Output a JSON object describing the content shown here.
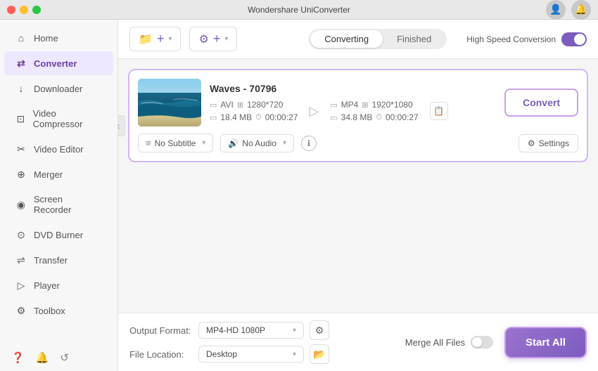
{
  "app": {
    "title": "Wondershare UniConverter"
  },
  "titlebar": {
    "dots": [
      "red",
      "yellow",
      "green"
    ]
  },
  "sidebar": {
    "items": [
      {
        "id": "home",
        "label": "Home",
        "icon": "⌂",
        "active": false
      },
      {
        "id": "converter",
        "label": "Converter",
        "icon": "⇄",
        "active": true
      },
      {
        "id": "downloader",
        "label": "Downloader",
        "icon": "↓",
        "active": false
      },
      {
        "id": "video-compressor",
        "label": "Video Compressor",
        "icon": "⊡",
        "active": false
      },
      {
        "id": "video-editor",
        "label": "Video Editor",
        "icon": "✂",
        "active": false
      },
      {
        "id": "merger",
        "label": "Merger",
        "icon": "⊕",
        "active": false
      },
      {
        "id": "screen-recorder",
        "label": "Screen Recorder",
        "icon": "◉",
        "active": false
      },
      {
        "id": "dvd-burner",
        "label": "DVD Burner",
        "icon": "⊙",
        "active": false
      },
      {
        "id": "transfer",
        "label": "Transfer",
        "icon": "⇌",
        "active": false
      },
      {
        "id": "player",
        "label": "Player",
        "icon": "▷",
        "active": false
      },
      {
        "id": "toolbox",
        "label": "Toolbox",
        "icon": "⚙",
        "active": false
      }
    ],
    "footer_icons": [
      "?",
      "🔔",
      "↺"
    ]
  },
  "toolbar": {
    "add_file_label": "+",
    "add_file_tooltip": "Add Files",
    "settings_label": "⚙",
    "tabs": {
      "converting": "Converting",
      "finished": "Finished"
    },
    "speed_label": "High Speed Conversion",
    "active_tab": "converting"
  },
  "file": {
    "name": "Waves - 70796",
    "source": {
      "format": "AVI",
      "resolution": "1280*720",
      "size": "18.4 MB",
      "duration": "00:00:27"
    },
    "output": {
      "format": "MP4",
      "resolution": "1920*1080",
      "size": "34.8 MB",
      "duration": "00:00:27"
    },
    "subtitle": "No Subtitle",
    "audio": "No Audio",
    "settings_label": "Settings"
  },
  "bottom": {
    "output_format_label": "Output Format:",
    "output_format_value": "MP4-HD 1080P",
    "file_location_label": "File Location:",
    "file_location_value": "Desktop",
    "merge_label": "Merge All Files",
    "start_all_label": "Start All"
  },
  "convert_button_label": "Convert",
  "collapse_icon": "‹"
}
